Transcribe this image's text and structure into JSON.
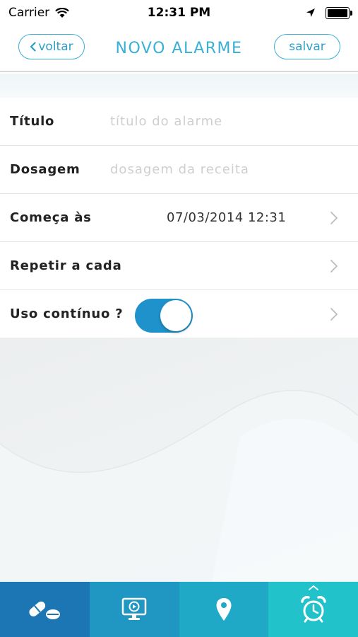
{
  "status_bar": {
    "carrier": "Carrier",
    "time": "12:31 PM"
  },
  "nav": {
    "back_label": "voltar",
    "title": "NOVO ALARME",
    "save_label": "salvar"
  },
  "form": {
    "title": {
      "label": "Título",
      "placeholder": "título do alarme"
    },
    "dosage": {
      "label": "Dosagem",
      "placeholder": "dosagem da receita"
    },
    "start": {
      "label": "Começa às",
      "value": "07/03/2014 12:31"
    },
    "repeat": {
      "label": "Repetir a cada"
    },
    "continuous": {
      "label": "Uso contínuo ?",
      "toggle_on": true
    }
  },
  "tabs": [
    {
      "icon": "pills-icon"
    },
    {
      "icon": "monitor-play-icon"
    },
    {
      "icon": "map-pin-icon"
    },
    {
      "icon": "alarm-clock-icon"
    }
  ],
  "colors": {
    "accent": "#3ab0d6",
    "toggle_on": "#1f92cc",
    "tab1": "#1b76b3",
    "tab2": "#2096c3",
    "tab3": "#1fa9c6",
    "tab4": "#22c2cb"
  }
}
